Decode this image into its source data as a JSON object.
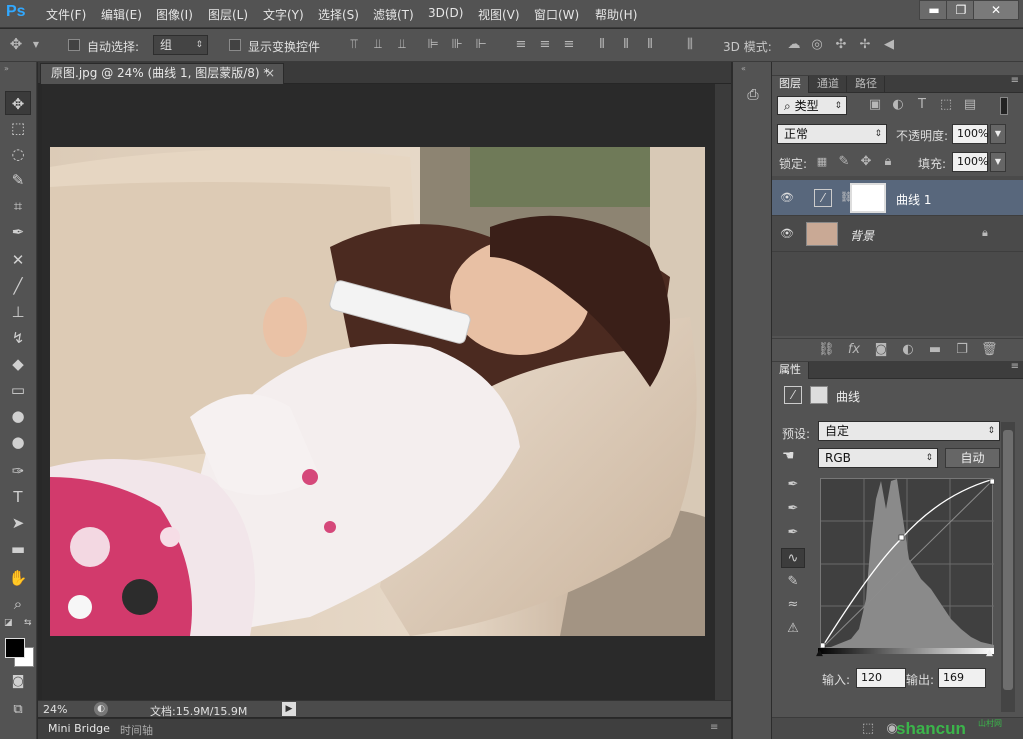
{
  "app": {
    "logo": "Ps"
  },
  "menu": [
    "文件(F)",
    "编辑(E)",
    "图像(I)",
    "图层(L)",
    "文字(Y)",
    "选择(S)",
    "滤镜(T)",
    "3D(D)",
    "视图(V)",
    "窗口(W)",
    "帮助(H)"
  ],
  "window_buttons": {
    "minimize": "▬",
    "restore": "❐",
    "close": "✕"
  },
  "options": {
    "auto_select_label": "自动选择:",
    "auto_select_value": "组",
    "show_transform_label": "显示变换控件",
    "mode3d_label": "3D 模式:"
  },
  "document": {
    "tab_title": "原图.jpg @ 24% (曲线 1, 图层蒙版/8) *",
    "tab_close": "×",
    "zoom": "24%",
    "doc_info": "文档:15.9M/15.9M"
  },
  "bottom_tabs": [
    "Mini Bridge",
    "时间轴"
  ],
  "layers_panel": {
    "tabs": [
      "图层",
      "通道",
      "路径"
    ],
    "filter_label": "类型",
    "blend_mode": "正常",
    "opacity_label": "不透明度:",
    "opacity_value": "100%",
    "lock_label": "锁定:",
    "fill_label": "填充:",
    "fill_value": "100%",
    "layers": [
      {
        "name": "曲线 1",
        "selected": true
      },
      {
        "name": "背景",
        "selected": false,
        "locked": true
      }
    ]
  },
  "properties_panel": {
    "tab": "属性",
    "title": "曲线",
    "preset_label": "预设:",
    "preset_value": "自定",
    "channel_value": "RGB",
    "auto_button": "自动",
    "input_label": "输入:",
    "input_value": "120",
    "output_label": "输出:",
    "output_value": "169"
  },
  "watermark": {
    "text": "shancun",
    "sub": "山村网"
  },
  "colors": {
    "accent": "#31a8ff",
    "selected_layer": "#58677c",
    "panel_bg": "#535353"
  }
}
